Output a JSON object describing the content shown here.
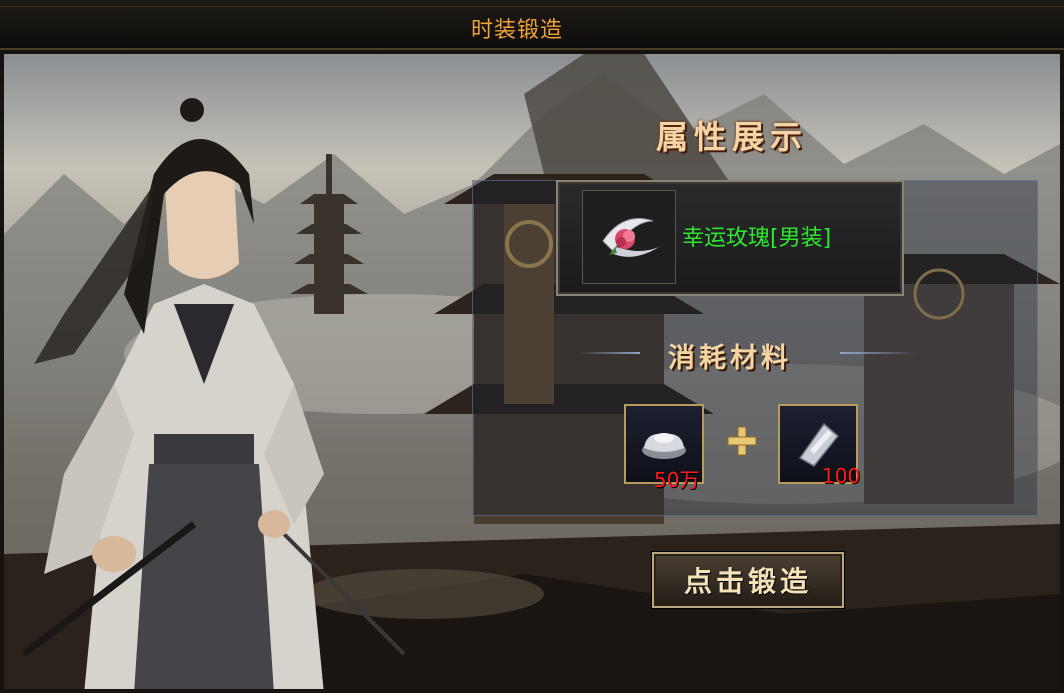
{
  "window": {
    "title": "时装锻造"
  },
  "attributes": {
    "heading": "属性展示"
  },
  "item": {
    "name": "幸运玫瑰[男装]",
    "icon": "rose-blade-icon",
    "name_color": "#2ee62e"
  },
  "materials": {
    "heading": "消耗材料",
    "list": [
      {
        "icon": "silver-ingot-icon",
        "count": "50万"
      },
      {
        "icon": "silver-blade-fragment-icon",
        "count": "100"
      }
    ]
  },
  "forge_button": {
    "label": "点击锻造"
  }
}
